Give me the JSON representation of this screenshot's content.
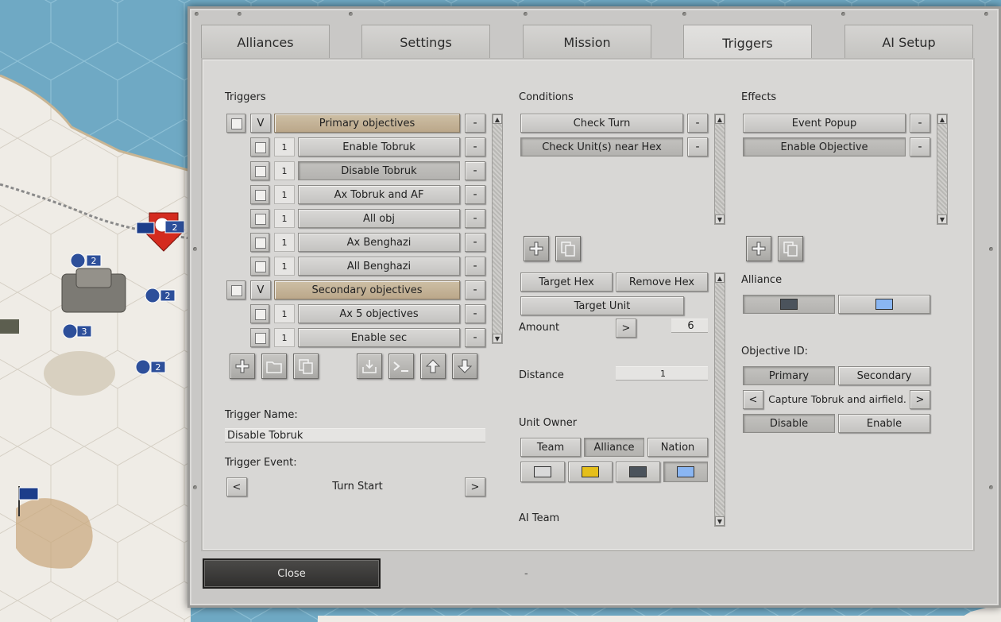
{
  "tabs": [
    "Alliances",
    "Settings",
    "Mission",
    "Triggers",
    "AI Setup"
  ],
  "active_tab": "Triggers",
  "triggers": {
    "heading": "Triggers",
    "rows": [
      {
        "kind": "group",
        "marker": "V",
        "label": "Primary objectives"
      },
      {
        "kind": "item",
        "count": "1",
        "label": "Enable Tobruk"
      },
      {
        "kind": "item",
        "count": "1",
        "label": "Disable Tobruk",
        "selected": true
      },
      {
        "kind": "item",
        "count": "1",
        "label": "Ax Tobruk and AF"
      },
      {
        "kind": "item",
        "count": "1",
        "label": "All obj"
      },
      {
        "kind": "item",
        "count": "1",
        "label": "Ax Benghazi"
      },
      {
        "kind": "item",
        "count": "1",
        "label": "All Benghazi"
      },
      {
        "kind": "group",
        "marker": "V",
        "label": "Secondary objectives"
      },
      {
        "kind": "item",
        "count": "1",
        "label": "Ax 5 objectives"
      },
      {
        "kind": "item",
        "count": "1",
        "label": "Enable sec"
      }
    ],
    "minus_label": "-",
    "name_label": "Trigger Name:",
    "name_value": "Disable Tobruk",
    "event_label": "Trigger Event:",
    "event_value": "Turn Start",
    "prev": "<",
    "next": ">"
  },
  "conditions": {
    "heading": "Conditions",
    "items": [
      "Check Turn",
      "Check Unit(s) near Hex"
    ],
    "target_hex": "Target Hex",
    "remove_hex": "Remove Hex",
    "target_unit": "Target Unit",
    "amount_label": "Amount",
    "amount_value": "6",
    "amount_btn": ">",
    "distance_label": "Distance",
    "distance_value": "1",
    "unit_owner_label": "Unit Owner",
    "owner_team": "Team",
    "owner_alliance": "Alliance",
    "owner_nation": "Nation",
    "ai_team_label": "AI Team",
    "swatch_colors": [
      "#d9d9d9",
      "#e5bf1b",
      "#4b535c",
      "#8ab6f2"
    ]
  },
  "effects": {
    "heading": "Effects",
    "items": [
      "Event Popup",
      "Enable Objective"
    ],
    "alliance_label": "Alliance",
    "alliance_colors": [
      "#4b535c",
      "#8ab6f2"
    ],
    "objective_label": "Objective ID:",
    "primary": "Primary",
    "secondary": "Secondary",
    "objective_value": "Capture Tobruk and airfield.",
    "prev": "<",
    "next": ">",
    "disable": "Disable",
    "enable": "Enable"
  },
  "map": {
    "badges": [
      "2",
      "2",
      "2",
      "3",
      "2"
    ]
  },
  "close_label": "Close",
  "footer_mark": "-"
}
